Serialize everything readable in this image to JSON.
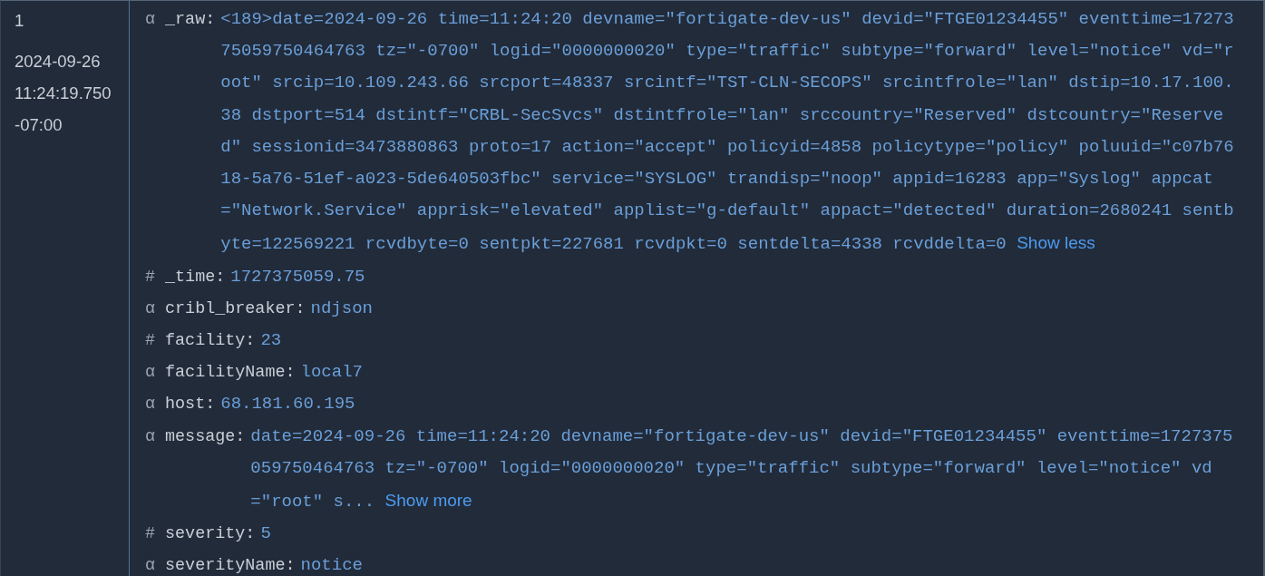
{
  "record": {
    "index": "1",
    "date": "2024-09-26",
    "time": "11:24:19.750",
    "offset": "-07:00"
  },
  "fields": [
    {
      "type": "α",
      "name": "_raw:",
      "value": "<189>date=2024-09-26 time=11:24:20 devname=\"fortigate-dev-us\" devid=\"FTGE01234455\" eventtime=1727375059750464763 tz=\"-0700\" logid=\"0000000020\" type=\"traffic\" subtype=\"forward\" level=\"notice\" vd=\"root\" srcip=10.109.243.66 srcport=48337 srcintf=\"TST-CLN-SECOPS\" srcintfrole=\"lan\" dstip=10.17.100.38 dstport=514 dstintf=\"CRBL-SecSvcs\" dstintfrole=\"lan\" srccountry=\"Reserved\" dstcountry=\"Reserved\" sessionid=3473880863 proto=17 action=\"accept\" policyid=4858 policytype=\"policy\" poluuid=\"c07b7618-5a76-51ef-a023-5de640503fbc\" service=\"SYSLOG\" trandisp=\"noop\" appid=16283 app=\"Syslog\" appcat=\"Network.Service\" apprisk=\"elevated\" applist=\"g-default\" appact=\"detected\" duration=2680241 sentbyte=122569221 rcvdbyte=0 sentpkt=227681 rcvdpkt=0 sentdelta=4338 rcvddelta=0",
      "toggle": "Show less"
    },
    {
      "type": "#",
      "name": "_time:",
      "value": "1727375059.75"
    },
    {
      "type": "α",
      "name": "cribl_breaker:",
      "value": "ndjson"
    },
    {
      "type": "#",
      "name": "facility:",
      "value": "23"
    },
    {
      "type": "α",
      "name": "facilityName:",
      "value": "local7"
    },
    {
      "type": "α",
      "name": "host:",
      "value": "68.181.60.195"
    },
    {
      "type": "α",
      "name": "message:",
      "value": "date=2024-09-26 time=11:24:20 devname=\"fortigate-dev-us\" devid=\"FTGE01234455\" eventtime=1727375059750464763 tz=\"-0700\" logid=\"0000000020\" type=\"traffic\" subtype=\"forward\" level=\"notice\" vd=\"root\" s...",
      "toggle": "Show more"
    },
    {
      "type": "#",
      "name": "severity:",
      "value": "5"
    },
    {
      "type": "α",
      "name": "severityName:",
      "value": "notice"
    }
  ]
}
